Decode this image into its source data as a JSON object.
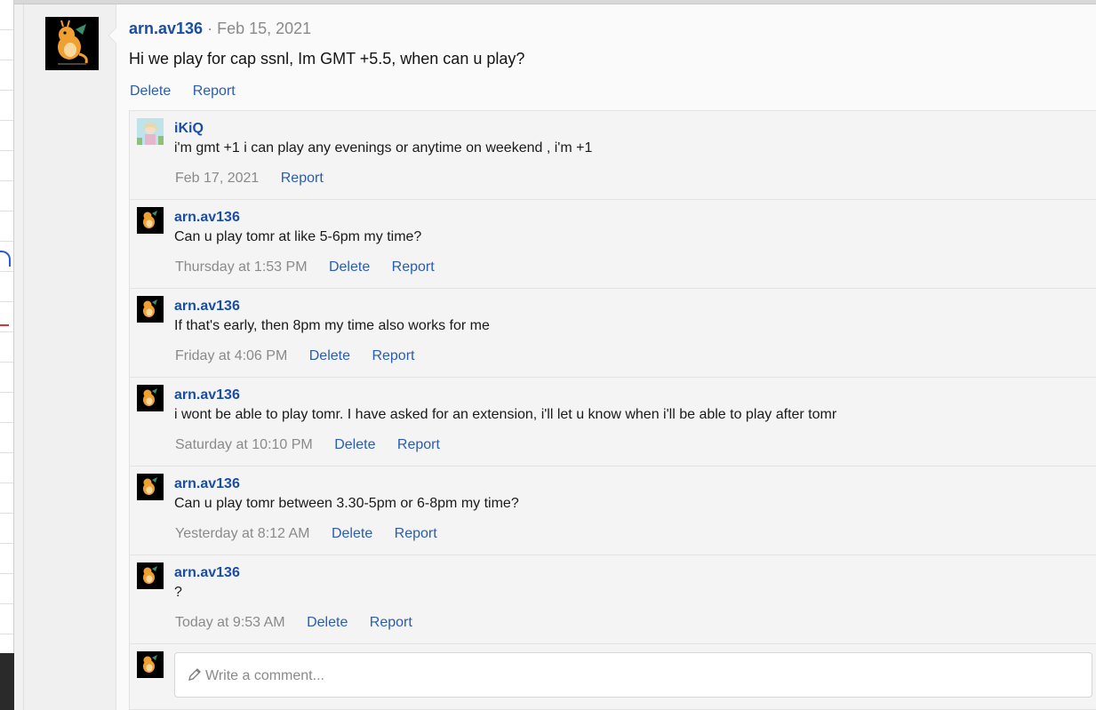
{
  "post": {
    "author": "arn.av136",
    "separator": "·",
    "date": "Feb 15, 2021",
    "body": "Hi we play for cap ssnl, Im GMT +5.5, when can u play?",
    "actions": [
      "Delete",
      "Report"
    ]
  },
  "comments": [
    {
      "author": "iKiQ",
      "text": "i'm gmt +1 i can play any evenings or anytime on weekend , i'm +1",
      "time": "Feb 17, 2021",
      "delete": "",
      "report": "Report",
      "avatar": "anime-avatar"
    },
    {
      "author": "arn.av136",
      "text": "Can u play tomr at like 5-6pm my time?",
      "time": "Thursday at 1:53 PM",
      "delete": "Delete",
      "report": "Report",
      "avatar": "dragon-avatar"
    },
    {
      "author": "arn.av136",
      "text": "If that's early, then 8pm my time also works for me",
      "time": "Friday at 4:06 PM",
      "delete": "Delete",
      "report": "Report",
      "avatar": "dragon-avatar"
    },
    {
      "author": "arn.av136",
      "text": "i wont be able to play tomr. I have asked for an extension, i'll let u know when i'll be able to play after tomr",
      "time": "Saturday at 10:10 PM",
      "delete": "Delete",
      "report": "Report",
      "avatar": "dragon-avatar"
    },
    {
      "author": "arn.av136",
      "text": "Can u play tomr between 3.30-5pm or 6-8pm my time?",
      "time": "Yesterday at 8:12 AM",
      "delete": "Delete",
      "report": "Report",
      "avatar": "dragon-avatar"
    },
    {
      "author": "arn.av136",
      "text": "?",
      "time": "Today at 9:53 AM",
      "delete": "Delete",
      "report": "Report",
      "avatar": "dragon-avatar"
    }
  ],
  "composer": {
    "placeholder": "Write a comment..."
  },
  "icons": {
    "pencil": "pencil-icon"
  },
  "colors": {
    "link": "#2a5db0",
    "username": "#1b4ea3",
    "muted": "#8a8a8a"
  }
}
